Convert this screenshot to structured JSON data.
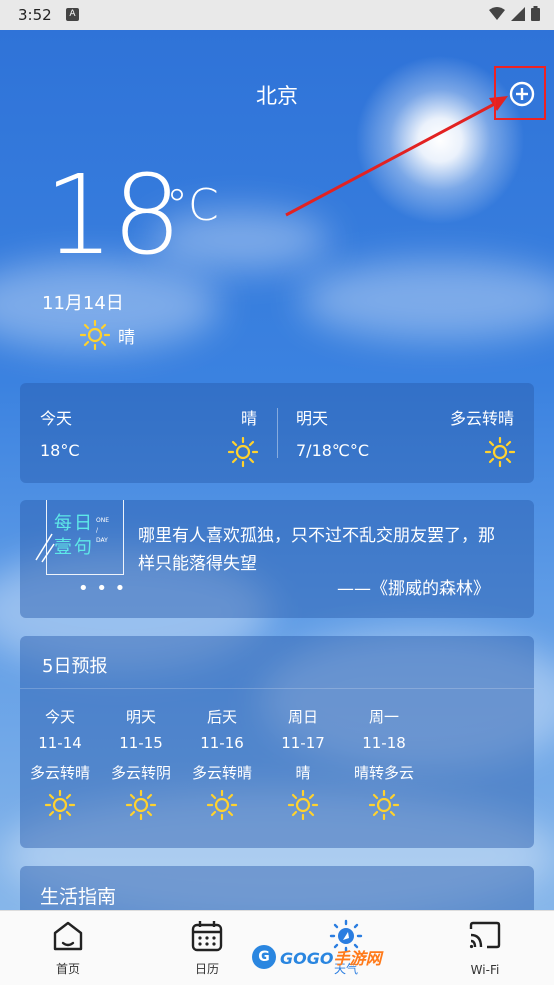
{
  "status_bar": {
    "time": "3:52",
    "a_label": "A"
  },
  "header": {
    "city": "北京"
  },
  "current": {
    "temp": "18",
    "unit": "°C",
    "date": "11月14日",
    "condition": "晴",
    "icon": "sun-icon"
  },
  "today_tomorrow": {
    "today": {
      "label": "今天",
      "condition": "晴",
      "temp": "18°C"
    },
    "tomorrow": {
      "label": "明天",
      "condition": "多云转晴",
      "temp": "7/18℃°C"
    }
  },
  "daily_quote": {
    "badge_line1": "每日",
    "badge_line2": "壹句",
    "badge_en1": "ONE",
    "badge_en2": "/",
    "badge_en3": "DAY",
    "dots": "• • •",
    "text": "哪里有人喜欢孤独，只不过不乱交朋友罢了，那样只能落得失望",
    "source": "——《挪威的森林》"
  },
  "forecast": {
    "title": "5日预报",
    "days": [
      {
        "day": "今天",
        "date": "11-14",
        "condition": "多云转晴"
      },
      {
        "day": "明天",
        "date": "11-15",
        "condition": "多云转阴"
      },
      {
        "day": "后天",
        "date": "11-16",
        "condition": "多云转晴"
      },
      {
        "day": "周日",
        "date": "11-17",
        "condition": "晴"
      },
      {
        "day": "周一",
        "date": "11-18",
        "condition": "晴转多云"
      }
    ]
  },
  "life_guide": {
    "title": "生活指南"
  },
  "tabs": [
    {
      "label": "首页",
      "icon": "home-icon"
    },
    {
      "label": "日历",
      "icon": "calendar-icon"
    },
    {
      "label": "天气",
      "icon": "weather-icon"
    },
    {
      "label": "Wi-Fi",
      "icon": "cast-icon"
    }
  ],
  "watermark": {
    "letters": "G",
    "prefix": "GOGO",
    "suffix": "手游网"
  },
  "colors": {
    "sky_top": "#2f73d8",
    "sun_yellow": "#ffd22e",
    "accent_blue": "#2a86e0",
    "highlight_red": "#e22222"
  }
}
